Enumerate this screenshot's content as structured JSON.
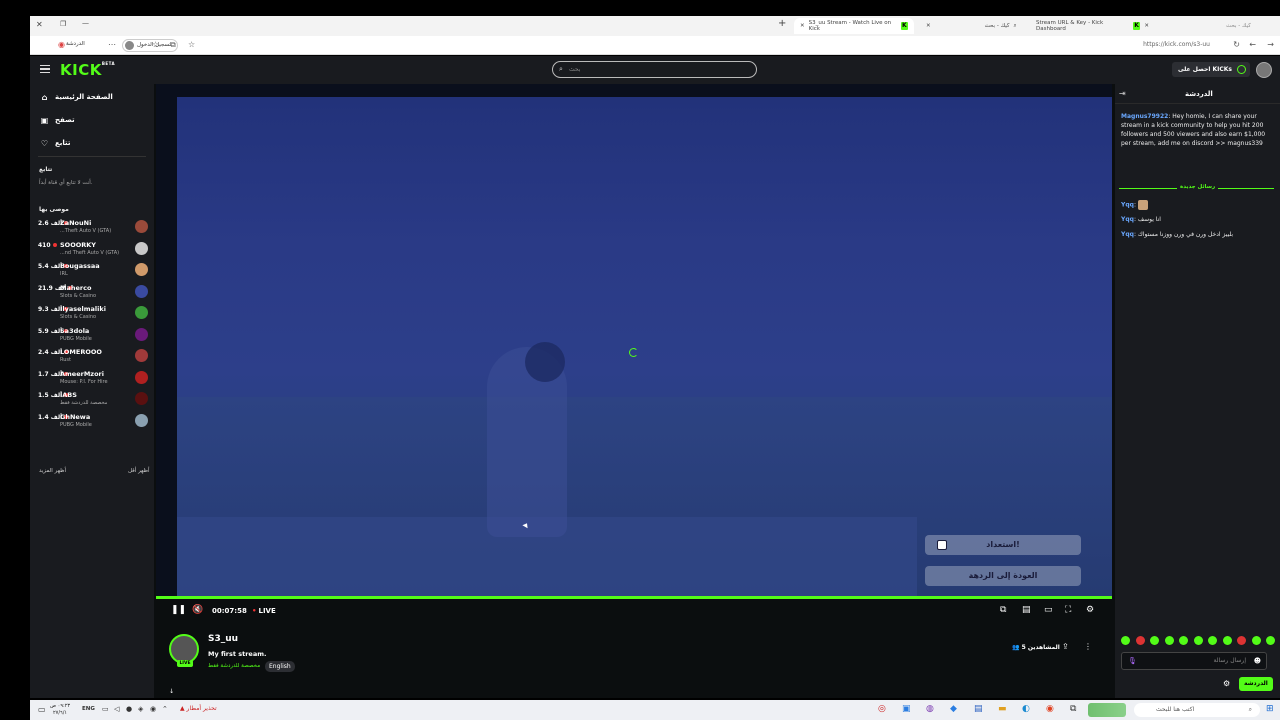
{
  "browser": {
    "tabs": [
      {
        "title": "S3_uu Stream - Watch Live on Kick",
        "active": true
      },
      {
        "title": "كيك - بحث",
        "active": false
      },
      {
        "title": "Stream URL & Key - Kick Dashboard",
        "active": false
      },
      {
        "title": "كيك - بحث",
        "active": false
      }
    ],
    "url": "https://kick.com/s3-uu",
    "signin_label": "تسجيل الدخول",
    "reading_mode": "الدردشة"
  },
  "site": {
    "logo": "KICK",
    "logo_badge": "BETA",
    "search_placeholder": "بحث",
    "kicks_button": "احصل على KICKs",
    "accent_color": "#53fc18"
  },
  "sidebar": {
    "nav": [
      {
        "label": "الصفحة الرئيسية",
        "icon": "home-icon"
      },
      {
        "label": "تصفح",
        "icon": "browse-icon"
      },
      {
        "label": "تتابع",
        "icon": "heart-icon"
      }
    ],
    "following_title": "تتابع",
    "following_empty": "أنت لا تتابع أي قناة أبداً.",
    "recommended_title": "موصى بها",
    "recommended": [
      {
        "name": "ZaNouNi",
        "category": "...Theft Auto V (GTA)",
        "viewers": "2.6 ألف",
        "avatar_color": "#9a4a3a"
      },
      {
        "name": "SOOORKY",
        "category": "...nd Theft Auto V (GTA)",
        "viewers": "410",
        "avatar_color": "#c8c8c8"
      },
      {
        "name": "Bougassaa",
        "category": "IRL",
        "viewers": "5.4 ألف",
        "avatar_color": "#d09a6a"
      },
      {
        "name": "Maherco",
        "category": "Slots & Casino",
        "viewers": "21.9 ألف",
        "avatar_color": "#3a4aa0"
      },
      {
        "name": "Ilyaselmaliki",
        "category": "Slots & Casino",
        "viewers": "9.3 ألف",
        "avatar_color": "#3a9a3a"
      },
      {
        "name": "Sa3dola",
        "category": "PUBG Mobile",
        "viewers": "5.9 ألف",
        "avatar_color": "#6a1a7a"
      },
      {
        "name": "LOMEROOO",
        "category": "Rust",
        "viewers": "2.4 ألف",
        "avatar_color": "#a03a3a"
      },
      {
        "name": "AmeerMzori",
        "category": "Mouse: P.I. For Hire",
        "viewers": "1.7 ألف",
        "avatar_color": "#b02020"
      },
      {
        "name": "iABS",
        "category": "مخصصة للدردشة فقط",
        "viewers": "1.5 ألف",
        "avatar_color": "#5a1010"
      },
      {
        "name": "GhNewa",
        "category": "PUBG Mobile",
        "viewers": "1.4 ألف",
        "avatar_color": "#8aa0b0"
      }
    ],
    "show_more": "أظهر المزيد",
    "show_less": "أظهر أقل"
  },
  "player": {
    "elapsed": "00:07:58",
    "live_label": "LIVE",
    "overlay_buttons": [
      "استعداد!",
      "العودة إلى الردهة"
    ]
  },
  "channel": {
    "name": "S3_uu",
    "title": "My first stream.",
    "category": "مخصصة للدردشة فقط",
    "language": "English",
    "viewers_label": "5 المشاهدين",
    "live_badge": "LIVE"
  },
  "chat": {
    "title": "الدردشة",
    "messages": [
      {
        "user": "Magnus79922",
        "text": "Hey homie, I can share your stream in a kick community to help you hit 200 followers and 500 viewers and also earn $1,000 per stream, add me on discord >> magnus339"
      }
    ],
    "new_messages_label": "رسائل جديدة",
    "new_messages": [
      {
        "user": "Yqq",
        "text": ""
      },
      {
        "user": "Yqq",
        "text": "انا يوسف"
      },
      {
        "user": "Yqq",
        "text": "بلييز ادخل ورن في ورن ووزنا مستواك"
      }
    ],
    "input_placeholder": "إرسال رسالة",
    "send_label": "الدردشة"
  },
  "taskbar": {
    "time": "٠٩:٢٣ ص",
    "date": "٢٧/٦/١",
    "lang": "ENG",
    "weather": "تحذير أمطار",
    "search_placeholder": "اكتب هنا للبحث"
  }
}
